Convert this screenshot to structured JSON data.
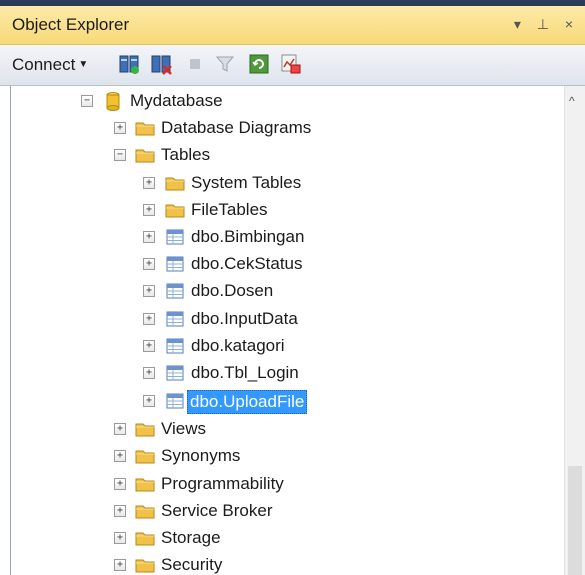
{
  "window": {
    "title": "Object Explorer",
    "controls": "▾ ⊥ ×"
  },
  "toolbar": {
    "connect_label": "Connect",
    "icons": [
      "connect-server-icon",
      "disconnect-icon",
      "stop-icon",
      "filter-icon",
      "refresh-icon",
      "activity-monitor-icon"
    ]
  },
  "tree": {
    "database": "Mydatabase",
    "items": {
      "diagrams": "Database Diagrams",
      "tables": "Tables",
      "system_tables": "System Tables",
      "file_tables": "FileTables",
      "t1": "dbo.Bimbingan",
      "t2": "dbo.CekStatus",
      "t3": "dbo.Dosen",
      "t4": "dbo.InputData",
      "t5": "dbo.katagori",
      "t6": "dbo.Tbl_Login",
      "t7": "dbo.UploadFile",
      "views": "Views",
      "synonyms": "Synonyms",
      "programmability": "Programmability",
      "service_broker": "Service Broker",
      "storage": "Storage",
      "security": "Security"
    },
    "selected": "dbo.UploadFile"
  },
  "colors": {
    "selection": "#3399ff",
    "title_bar": "#f7d979",
    "folder": "#f0c24a"
  }
}
